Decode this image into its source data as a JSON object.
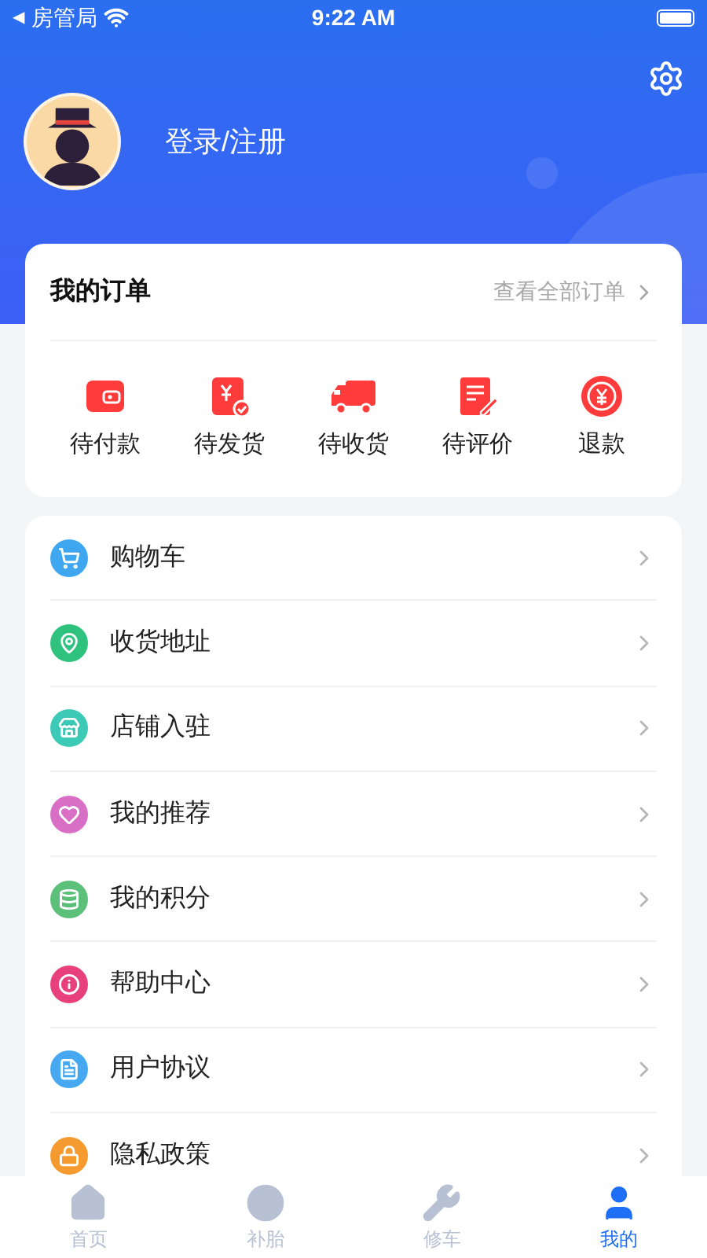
{
  "status_bar": {
    "back": "◀",
    "carrier": "房管局",
    "time": "9:22 AM"
  },
  "profile": {
    "login": "登录/注册"
  },
  "orders": {
    "title": "我的订单",
    "view_all": "查看全部订单",
    "items": [
      {
        "label": "待付款"
      },
      {
        "label": "待发货"
      },
      {
        "label": "待收货"
      },
      {
        "label": "待评价"
      },
      {
        "label": "退款"
      }
    ]
  },
  "menu": [
    {
      "label": "购物车",
      "color": "#3fa7f0"
    },
    {
      "label": "收货地址",
      "color": "#2ec27e"
    },
    {
      "label": "店铺入驻",
      "color": "#3cc9b5"
    },
    {
      "label": "我的推荐",
      "color": "#d96fc5"
    },
    {
      "label": "我的积分",
      "color": "#5cbf7a"
    },
    {
      "label": "帮助中心",
      "color": "#e8407a"
    },
    {
      "label": "用户协议",
      "color": "#46a8f0"
    },
    {
      "label": "隐私政策",
      "color": "#f59a2e"
    }
  ],
  "tabs": [
    {
      "label": "首页",
      "selected": false
    },
    {
      "label": "补胎",
      "selected": false
    },
    {
      "label": "修车",
      "selected": false
    },
    {
      "label": "我的",
      "selected": true
    }
  ]
}
